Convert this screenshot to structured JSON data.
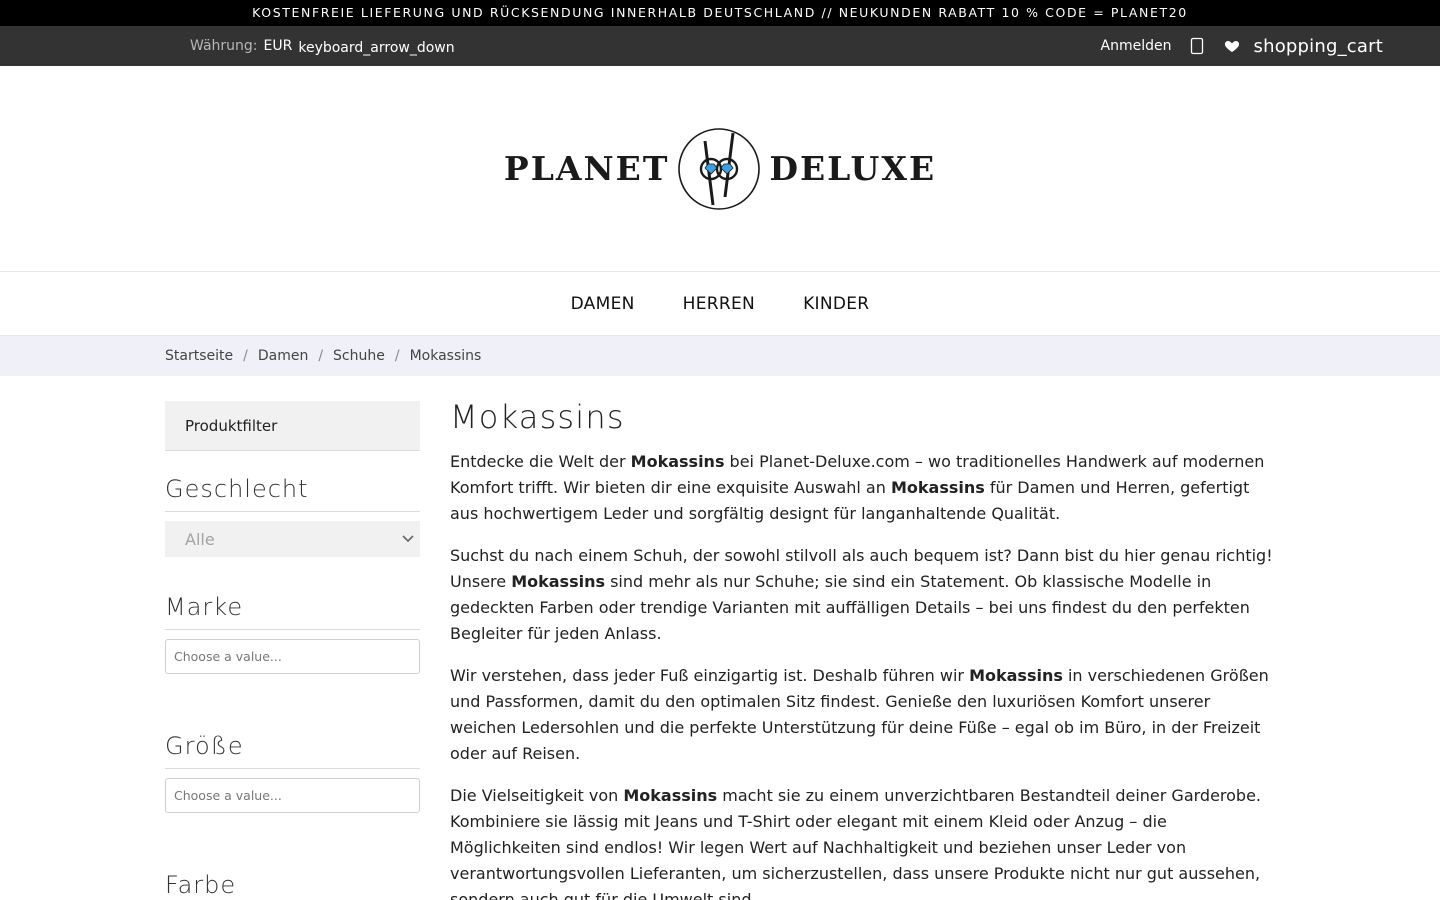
{
  "promo": {
    "text": "KOSTENFREIE LIEFERUNG UND RÜCKSENDUNG INNERHALB DEUTSCHLAND // NEUKUNDEN RABATT 10 % CODE = PLANET20"
  },
  "topbar": {
    "currency_label": "Währung:",
    "currency_value": "EUR",
    "currency_arrow": "keyboard_arrow_down",
    "login": "Anmelden",
    "cart": "shopping_cart"
  },
  "logo": {
    "left": "PLANET",
    "right": "DELUXE"
  },
  "nav": {
    "damen": "DAMEN",
    "herren": "HERREN",
    "kinder": "KINDER"
  },
  "breadcrumb": {
    "home": "Startseite",
    "level1": "Damen",
    "level2": "Schuhe",
    "current": "Mokassins",
    "sep": "/"
  },
  "sidebar": {
    "filter_header": "Produktfilter",
    "gender_title": "Geschlecht",
    "gender_value": "Alle",
    "brand_title": "Marke",
    "brand_placeholder": "Choose a value...",
    "size_title": "Größe",
    "size_placeholder": "Choose a value...",
    "color_title": "Farbe"
  },
  "main": {
    "title": "Mokassins",
    "kw": "Mokassins",
    "p1": {
      "a": "Entdecke die Welt der ",
      "b": " bei Planet-Deluxe.com – wo traditionelles Handwerk auf modernen Komfort trifft. Wir bieten dir eine exquisite Auswahl an ",
      "c": " für Damen und Herren, gefertigt aus hochwertigem Leder und sorgfältig designt für langanhaltende Qualität."
    },
    "p2": {
      "a": "Suchst du nach einem Schuh, der sowohl stilvoll als auch bequem ist? Dann bist du hier genau richtig! Unsere ",
      "b": " sind mehr als nur Schuhe; sie sind ein Statement. Ob klassische Modelle in gedeckten Farben oder trendige Varianten mit auffälligen Details – bei uns findest du den perfekten Begleiter für jeden Anlass."
    },
    "p3": {
      "a": "Wir verstehen, dass jeder Fuß einzigartig ist. Deshalb führen wir ",
      "b": " in verschiedenen Größen und Passformen, damit du den optimalen Sitz findest. Genieße den luxuriösen Komfort unserer weichen Ledersohlen und die perfekte Unterstützung für deine Füße – egal ob im Büro, in der Freizeit oder auf Reisen."
    },
    "p4": {
      "a": "Die Vielseitigkeit von ",
      "b": " macht sie zu einem unverzichtbaren Bestandteil deiner Garderobe. Kombiniere sie lässig mit Jeans und T-Shirt oder elegant mit einem Kleid oder Anzug – die Möglichkeiten sind endlos! Wir legen Wert auf Nachhaltigkeit und beziehen unser Leder von verantwortungsvollen Lieferanten, um sicherzustellen, dass unsere Produkte nicht nur gut aussehen, sondern auch gut für die Umwelt sind."
    }
  },
  "icons": {
    "user": "user-icon",
    "heart": "heart-icon",
    "logo": "planet-deluxe-logo-mark"
  }
}
